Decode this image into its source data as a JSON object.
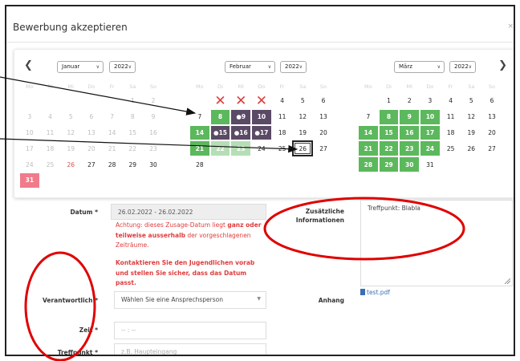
{
  "modal": {
    "title": "Bewerbung akzeptieren",
    "close": "×"
  },
  "calendar": {
    "prev": "❮",
    "next": "❯",
    "weekdays": [
      "Mo",
      "Di",
      "Mi",
      "Do",
      "Fr",
      "Sa",
      "So"
    ],
    "months": [
      {
        "name": "Januar",
        "year": "2022",
        "rows": [
          [
            {
              "d": "",
              "s": "muted"
            },
            {
              "d": "",
              "s": "muted"
            },
            {
              "d": "",
              "s": "muted"
            },
            {
              "d": "",
              "s": "muted"
            },
            {
              "d": "",
              "s": "muted"
            },
            {
              "d": "1",
              "s": "muted"
            },
            {
              "d": "2",
              "s": "muted"
            }
          ],
          [
            {
              "d": "3",
              "s": "muted"
            },
            {
              "d": "4",
              "s": "muted"
            },
            {
              "d": "5",
              "s": "muted"
            },
            {
              "d": "6",
              "s": "muted"
            },
            {
              "d": "7",
              "s": "muted"
            },
            {
              "d": "8",
              "s": "muted"
            },
            {
              "d": "9",
              "s": "muted"
            }
          ],
          [
            {
              "d": "10",
              "s": "muted"
            },
            {
              "d": "11",
              "s": "muted"
            },
            {
              "d": "12",
              "s": "muted"
            },
            {
              "d": "13",
              "s": "muted"
            },
            {
              "d": "14",
              "s": "muted"
            },
            {
              "d": "15",
              "s": "muted"
            },
            {
              "d": "16",
              "s": "muted"
            }
          ],
          [
            {
              "d": "17",
              "s": "muted"
            },
            {
              "d": "18",
              "s": "muted"
            },
            {
              "d": "19",
              "s": "muted"
            },
            {
              "d": "20",
              "s": "muted"
            },
            {
              "d": "21",
              "s": "muted"
            },
            {
              "d": "22",
              "s": "muted"
            },
            {
              "d": "23",
              "s": "muted"
            }
          ],
          [
            {
              "d": "24",
              "s": "muted"
            },
            {
              "d": "25",
              "s": "muted"
            },
            {
              "d": "26",
              "s": "red"
            },
            {
              "d": "27",
              "s": ""
            },
            {
              "d": "28",
              "s": ""
            },
            {
              "d": "29",
              "s": ""
            },
            {
              "d": "30",
              "s": ""
            }
          ],
          [
            {
              "d": "31",
              "s": "pink"
            }
          ]
        ]
      },
      {
        "name": "Februar",
        "year": "2022",
        "rows": [
          [
            {
              "d": "",
              "s": ""
            },
            {
              "d": "✕",
              "s": "xmark"
            },
            {
              "d": "✕",
              "s": "xmark"
            },
            {
              "d": "✕",
              "s": "xmark"
            },
            {
              "d": "4",
              "s": ""
            },
            {
              "d": "5",
              "s": ""
            },
            {
              "d": "6",
              "s": ""
            }
          ],
          [
            {
              "d": "7",
              "s": ""
            },
            {
              "d": "8",
              "s": "green"
            },
            {
              "d": "●9",
              "s": "purple"
            },
            {
              "d": "10",
              "s": "purple"
            },
            {
              "d": "11",
              "s": ""
            },
            {
              "d": "12",
              "s": ""
            },
            {
              "d": "13",
              "s": ""
            }
          ],
          [
            {
              "d": "14",
              "s": "green"
            },
            {
              "d": "●15",
              "s": "purple"
            },
            {
              "d": "●16",
              "s": "purple"
            },
            {
              "d": "●17",
              "s": "purple"
            },
            {
              "d": "18",
              "s": ""
            },
            {
              "d": "19",
              "s": ""
            },
            {
              "d": "20",
              "s": ""
            }
          ],
          [
            {
              "d": "21",
              "s": "green"
            },
            {
              "d": "22",
              "s": "green fade"
            },
            {
              "d": "23",
              "s": "green fade"
            },
            {
              "d": "24",
              "s": ""
            },
            {
              "d": "25",
              "s": ""
            },
            {
              "d": "26",
              "s": "outlined"
            },
            {
              "d": "27",
              "s": ""
            }
          ],
          [
            {
              "d": "28",
              "s": ""
            }
          ]
        ]
      },
      {
        "name": "März",
        "year": "2022",
        "rows": [
          [
            {
              "d": "",
              "s": ""
            },
            {
              "d": "1",
              "s": ""
            },
            {
              "d": "2",
              "s": ""
            },
            {
              "d": "3",
              "s": ""
            },
            {
              "d": "4",
              "s": ""
            },
            {
              "d": "5",
              "s": ""
            },
            {
              "d": "6",
              "s": ""
            }
          ],
          [
            {
              "d": "7",
              "s": ""
            },
            {
              "d": "8",
              "s": "green"
            },
            {
              "d": "9",
              "s": "green"
            },
            {
              "d": "10",
              "s": "green"
            },
            {
              "d": "11",
              "s": ""
            },
            {
              "d": "12",
              "s": ""
            },
            {
              "d": "13",
              "s": ""
            }
          ],
          [
            {
              "d": "14",
              "s": "green"
            },
            {
              "d": "15",
              "s": "green"
            },
            {
              "d": "16",
              "s": "green"
            },
            {
              "d": "17",
              "s": "green"
            },
            {
              "d": "18",
              "s": ""
            },
            {
              "d": "19",
              "s": ""
            },
            {
              "d": "20",
              "s": ""
            }
          ],
          [
            {
              "d": "21",
              "s": "green"
            },
            {
              "d": "22",
              "s": "green"
            },
            {
              "d": "23",
              "s": "green"
            },
            {
              "d": "24",
              "s": "green"
            },
            {
              "d": "25",
              "s": ""
            },
            {
              "d": "26",
              "s": ""
            },
            {
              "d": "27",
              "s": ""
            }
          ],
          [
            {
              "d": "28",
              "s": "green"
            },
            {
              "d": "29",
              "s": "green"
            },
            {
              "d": "30",
              "s": "green"
            },
            {
              "d": "31",
              "s": ""
            }
          ]
        ]
      }
    ]
  },
  "form": {
    "datum_label": "Datum *",
    "datum_value": "26.02.2022 - 26.02.2022",
    "warn_1": "Achtung: dieses Zusage-Datum liegt ",
    "warn_bold": "ganz oder teilweise ausserhalb",
    "warn_2": " der vorgeschlagenen Zeiträume.",
    "warn_contact": "Kontaktieren Sie den Jugendlichen vorab und stellen Sie sicher, dass das Datum passt.",
    "info_label": "Zusätzliche Informationen",
    "info_value": "Treffpunkt: Blabla",
    "verantwortlich_label": "Verantwortlich *",
    "verantwortlich_placeholder": "Wählen Sie eine Ansprechsperson",
    "anhang_label": "Anhang",
    "anhang_file": "test.pdf",
    "zeit_label": "Zeit *",
    "zeit_placeholder": "-- : --",
    "treffpunkt_label": "Treffpunkt *",
    "treffpunkt_placeholder": "z.B. Haupteingang"
  }
}
